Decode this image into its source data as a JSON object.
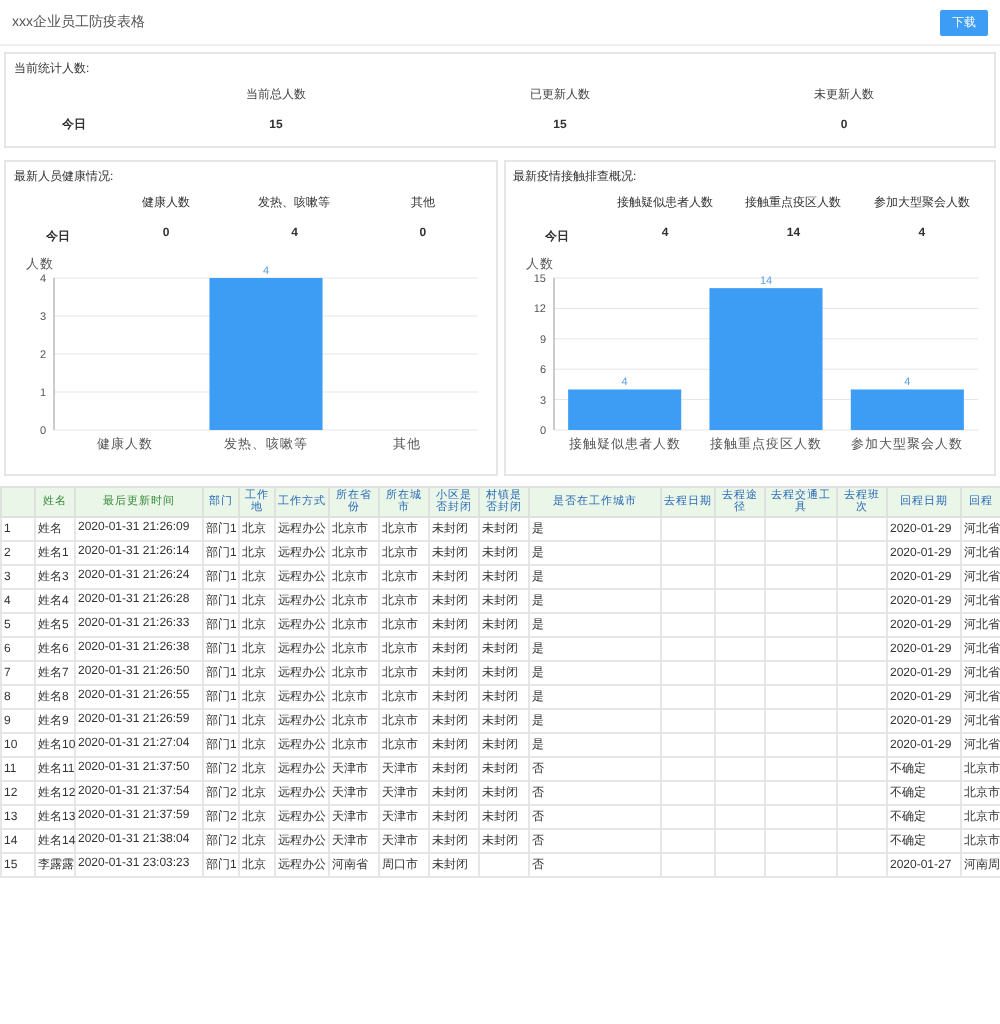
{
  "header": {
    "title": "xxx企业员工防疫表格",
    "download_button": "下载"
  },
  "totals": {
    "title": "当前统计人数:",
    "row_label": "今日",
    "columns": [
      {
        "label": "当前总人数",
        "value": "15"
      },
      {
        "label": "已更新人数",
        "value": "15"
      },
      {
        "label": "未更新人数",
        "value": "0"
      }
    ]
  },
  "panels": [
    {
      "title": "最新人员健康情况:",
      "row_label": "今日",
      "columns": [
        {
          "label": "健康人数",
          "value": "0"
        },
        {
          "label": "发热、咳嗽等",
          "value": "4"
        },
        {
          "label": "其他",
          "value": "0"
        }
      ],
      "chart_data": {
        "type": "bar",
        "ylabel": "人数",
        "categories": [
          "健康人数",
          "发热、咳嗽等",
          "其他"
        ],
        "series": [
          {
            "color": "#3d9df5",
            "values": [
              0,
              4,
              0
            ]
          }
        ],
        "ylim": [
          0,
          4
        ],
        "yticks": [
          0,
          1,
          2,
          3,
          4
        ],
        "grid": true,
        "value_labels": [
          null,
          "4",
          null
        ]
      }
    },
    {
      "title": "最新疫情接触排查概况:",
      "row_label": "今日",
      "columns": [
        {
          "label": "接触疑似患者人数",
          "value": "4"
        },
        {
          "label": "接触重点疫区人数",
          "value": "14"
        },
        {
          "label": "参加大型聚会人数",
          "value": "4"
        }
      ],
      "chart_data": {
        "type": "bar",
        "ylabel": "人数",
        "categories": [
          "接触疑似患者人数",
          "接触重点疫区人数",
          "参加大型聚会人数"
        ],
        "series": [
          {
            "color": "#3d9df5",
            "values": [
              4,
              14,
              4
            ]
          }
        ],
        "ylim": [
          0,
          15
        ],
        "yticks": [
          0,
          3,
          6,
          9,
          12,
          15
        ],
        "grid": true,
        "value_labels": [
          "4",
          "14",
          "4"
        ]
      }
    }
  ],
  "table": {
    "columns": [
      "",
      "姓名",
      "最后更新时间",
      "部门",
      "工作地",
      "工作方式",
      "所在省份",
      "所在城市",
      "小区是否封闭",
      "村镇是否封闭",
      "是否在工作城市",
      "去程日期",
      "去程途径",
      "去程交通工具",
      "去程班次",
      "回程日期",
      "回程"
    ],
    "rows": [
      [
        "1",
        "姓名",
        "2020-01-31 21:26:09",
        "部门1",
        "北京",
        "远程办公",
        "北京市",
        "北京市",
        "未封闭",
        "未封闭",
        "是",
        "",
        "",
        "",
        "",
        "2020-01-29",
        "河北省"
      ],
      [
        "2",
        "姓名1",
        "2020-01-31 21:26:14",
        "部门1",
        "北京",
        "远程办公",
        "北京市",
        "北京市",
        "未封闭",
        "未封闭",
        "是",
        "",
        "",
        "",
        "",
        "2020-01-29",
        "河北省"
      ],
      [
        "3",
        "姓名3",
        "2020-01-31 21:26:24",
        "部门1",
        "北京",
        "远程办公",
        "北京市",
        "北京市",
        "未封闭",
        "未封闭",
        "是",
        "",
        "",
        "",
        "",
        "2020-01-29",
        "河北省"
      ],
      [
        "4",
        "姓名4",
        "2020-01-31 21:26:28",
        "部门1",
        "北京",
        "远程办公",
        "北京市",
        "北京市",
        "未封闭",
        "未封闭",
        "是",
        "",
        "",
        "",
        "",
        "2020-01-29",
        "河北省"
      ],
      [
        "5",
        "姓名5",
        "2020-01-31 21:26:33",
        "部门1",
        "北京",
        "远程办公",
        "北京市",
        "北京市",
        "未封闭",
        "未封闭",
        "是",
        "",
        "",
        "",
        "",
        "2020-01-29",
        "河北省"
      ],
      [
        "6",
        "姓名6",
        "2020-01-31 21:26:38",
        "部门1",
        "北京",
        "远程办公",
        "北京市",
        "北京市",
        "未封闭",
        "未封闭",
        "是",
        "",
        "",
        "",
        "",
        "2020-01-29",
        "河北省"
      ],
      [
        "7",
        "姓名7",
        "2020-01-31 21:26:50",
        "部门1",
        "北京",
        "远程办公",
        "北京市",
        "北京市",
        "未封闭",
        "未封闭",
        "是",
        "",
        "",
        "",
        "",
        "2020-01-29",
        "河北省"
      ],
      [
        "8",
        "姓名8",
        "2020-01-31 21:26:55",
        "部门1",
        "北京",
        "远程办公",
        "北京市",
        "北京市",
        "未封闭",
        "未封闭",
        "是",
        "",
        "",
        "",
        "",
        "2020-01-29",
        "河北省"
      ],
      [
        "9",
        "姓名9",
        "2020-01-31 21:26:59",
        "部门1",
        "北京",
        "远程办公",
        "北京市",
        "北京市",
        "未封闭",
        "未封闭",
        "是",
        "",
        "",
        "",
        "",
        "2020-01-29",
        "河北省"
      ],
      [
        "10",
        "姓名10",
        "2020-01-31 21:27:04",
        "部门1",
        "北京",
        "远程办公",
        "北京市",
        "北京市",
        "未封闭",
        "未封闭",
        "是",
        "",
        "",
        "",
        "",
        "2020-01-29",
        "河北省"
      ],
      [
        "11",
        "姓名11",
        "2020-01-31 21:37:50",
        "部门2",
        "北京",
        "远程办公",
        "天津市",
        "天津市",
        "未封闭",
        "未封闭",
        "否",
        "",
        "",
        "",
        "",
        "不确定",
        "北京市"
      ],
      [
        "12",
        "姓名12",
        "2020-01-31 21:37:54",
        "部门2",
        "北京",
        "远程办公",
        "天津市",
        "天津市",
        "未封闭",
        "未封闭",
        "否",
        "",
        "",
        "",
        "",
        "不确定",
        "北京市"
      ],
      [
        "13",
        "姓名13",
        "2020-01-31 21:37:59",
        "部门2",
        "北京",
        "远程办公",
        "天津市",
        "天津市",
        "未封闭",
        "未封闭",
        "否",
        "",
        "",
        "",
        "",
        "不确定",
        "北京市"
      ],
      [
        "14",
        "姓名14",
        "2020-01-31 21:38:04",
        "部门2",
        "北京",
        "远程办公",
        "天津市",
        "天津市",
        "未封闭",
        "未封闭",
        "否",
        "",
        "",
        "",
        "",
        "不确定",
        "北京市"
      ],
      [
        "15",
        "李露露",
        "2020-01-31 23:03:23",
        "部门1",
        "北京",
        "远程办公",
        "河南省",
        "周口市",
        "未封闭",
        "",
        "否",
        "",
        "",
        "",
        "",
        "2020-01-27",
        "河南周"
      ]
    ]
  }
}
